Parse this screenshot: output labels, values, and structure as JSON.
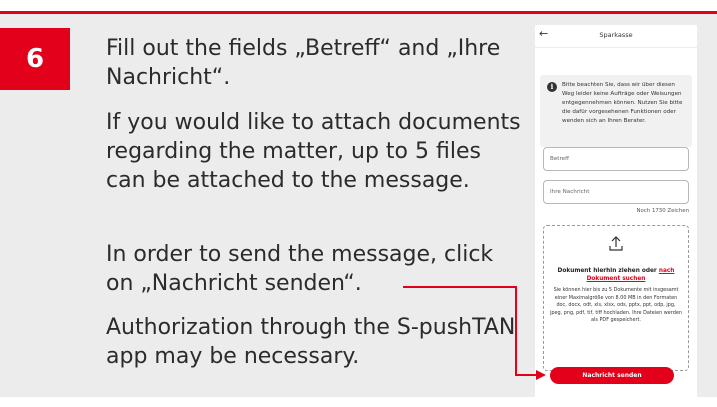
{
  "step": {
    "number": "6"
  },
  "instructions": [
    "Fill out the fields „Betreff“ and „Ihre Nachricht“.",
    "If you would like to attach documents regarding the matter, up to 5 files can be attached to the message.",
    "In order to send the message, click on „Nachricht senden“.",
    "Authorization through the S-pushTAN app may be necessary."
  ],
  "phone": {
    "back_icon": "arrow-left-icon",
    "title": "Sparkasse",
    "info_icon": "info-icon",
    "info_text": "Bitte beachten Sie, dass wir über diesen Weg leider keine Aufträge oder Weisungen entgegennehmen können. Nutzen Sie bitte die dafür vorgesehenen Funktionen oder wenden sich an Ihren Berater.",
    "subject_placeholder": "Betreff",
    "message_placeholder": "Ihre Nachricht",
    "char_counter": "Noch 1730 Zeichen",
    "upload_icon": "upload-icon",
    "drop_label": "Dokument hierhin ziehen oder",
    "drop_link": "nach Dokument suchen",
    "drop_info": "Sie können hier bis zu 5 Dokumente mit insgesamt einer Maximalgröße von 8.00 MB in den Formaten doc, docx, odt, xls, xlsx, ods, pptx, ppt, odp, jpg, jpeg, png, pdf, tif, tiff hochladen. Ihre Dateien werden als PDF gespeichert.",
    "send_button": "Nachricht senden"
  },
  "colors": {
    "accent": "#e2001a",
    "panel_bg": "#ececec"
  }
}
